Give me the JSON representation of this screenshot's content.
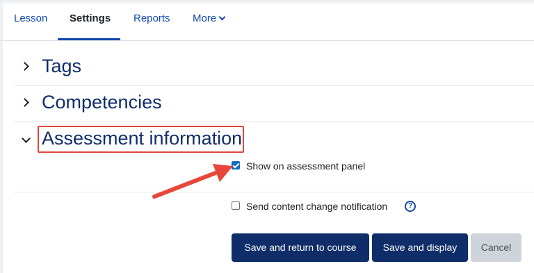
{
  "nav": {
    "tabs": [
      {
        "label": "Lesson"
      },
      {
        "label": "Settings",
        "active": true
      },
      {
        "label": "Reports"
      },
      {
        "label": "More"
      }
    ]
  },
  "sections": [
    {
      "title": "Tags",
      "expanded": false
    },
    {
      "title": "Competencies",
      "expanded": false
    },
    {
      "title": "Assessment information",
      "expanded": true
    }
  ],
  "options": {
    "show_on_panel": {
      "label": "Show on assessment panel",
      "checked": true
    },
    "send_notification": {
      "label": "Send content change notification",
      "checked": false,
      "help_icon": "question-circle-icon",
      "help_glyph": "?"
    }
  },
  "buttons": {
    "save_return": "Save and return to course",
    "save_display": "Save and display",
    "cancel": "Cancel"
  },
  "colors": {
    "primary": "#0f2d69",
    "link": "#0f47ad",
    "highlight": "#e0463d",
    "arrow": "#e8453b"
  }
}
